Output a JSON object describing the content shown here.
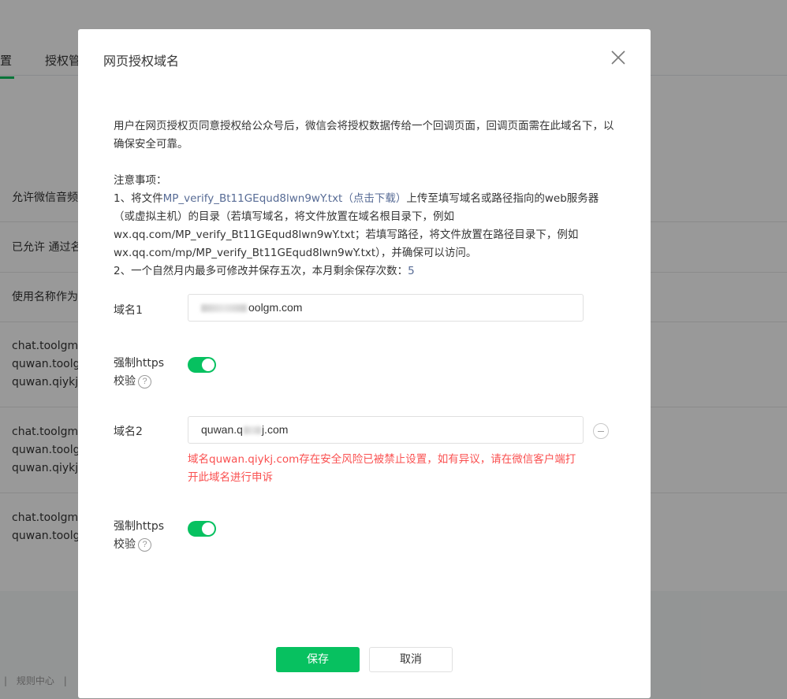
{
  "background": {
    "tabs": [
      "置",
      "授权管"
    ],
    "rows": [
      "允许微信音频",
      "已允许 通过名",
      "使用名称作为",
      "chat.toolgm.",
      "quwan.toolg",
      "quwan.qiykj.",
      "chat.toolgm.",
      "quwan.toolg",
      "quwan.qiykj.",
      "chat.toolgm.",
      "quwan.toolg"
    ],
    "footer_links": [
      "|",
      "规则中心",
      "|"
    ]
  },
  "dialog": {
    "title": "网页授权域名",
    "description": "用户在网页授权页同意授权给公众号后，微信会将授权数据传给一个回调页面，回调页面需在此域名下，以确保安全可靠。",
    "notes": {
      "heading": "注意事项：",
      "line1_prefix": "1、将文件",
      "file_link": "MP_verify_Bt11GEqud8lwn9wY.txt（点击下载）",
      "line1_suffix": "上传至填写域名或路径指向的web服务器（或虚拟主机）的目录（若填写域名，将文件放置在域名根目录下，例如wx.qq.com/MP_verify_Bt11GEqud8lwn9wY.txt；若填写路径，将文件放置在路径目录下，例如wx.qq.com/mp/MP_verify_Bt11GEqud8lwn9wY.txt），并确保可以访问。",
      "line2_prefix": "2、一个自然月内最多可修改并保存五次，本月剩余保存次数：",
      "remaining_count": "5"
    },
    "domain1": {
      "label": "域名1",
      "value_suffix": "oolgm.com"
    },
    "https1": {
      "label_line1": "强制https",
      "label_line2": "校验",
      "help": "?",
      "enabled": true
    },
    "domain2": {
      "label": "域名2",
      "value_prefix": "quwan.q",
      "value_suffix": "j.com"
    },
    "domain2_error": "域名quwan.qiykj.com存在安全风险已被禁止设置，如有异议，请在微信客户端打开此域名进行申诉",
    "https2": {
      "label_line1": "强制https",
      "label_line2": "校验",
      "help": "?",
      "enabled": true
    },
    "save_label": "保存",
    "cancel_label": "取消"
  }
}
